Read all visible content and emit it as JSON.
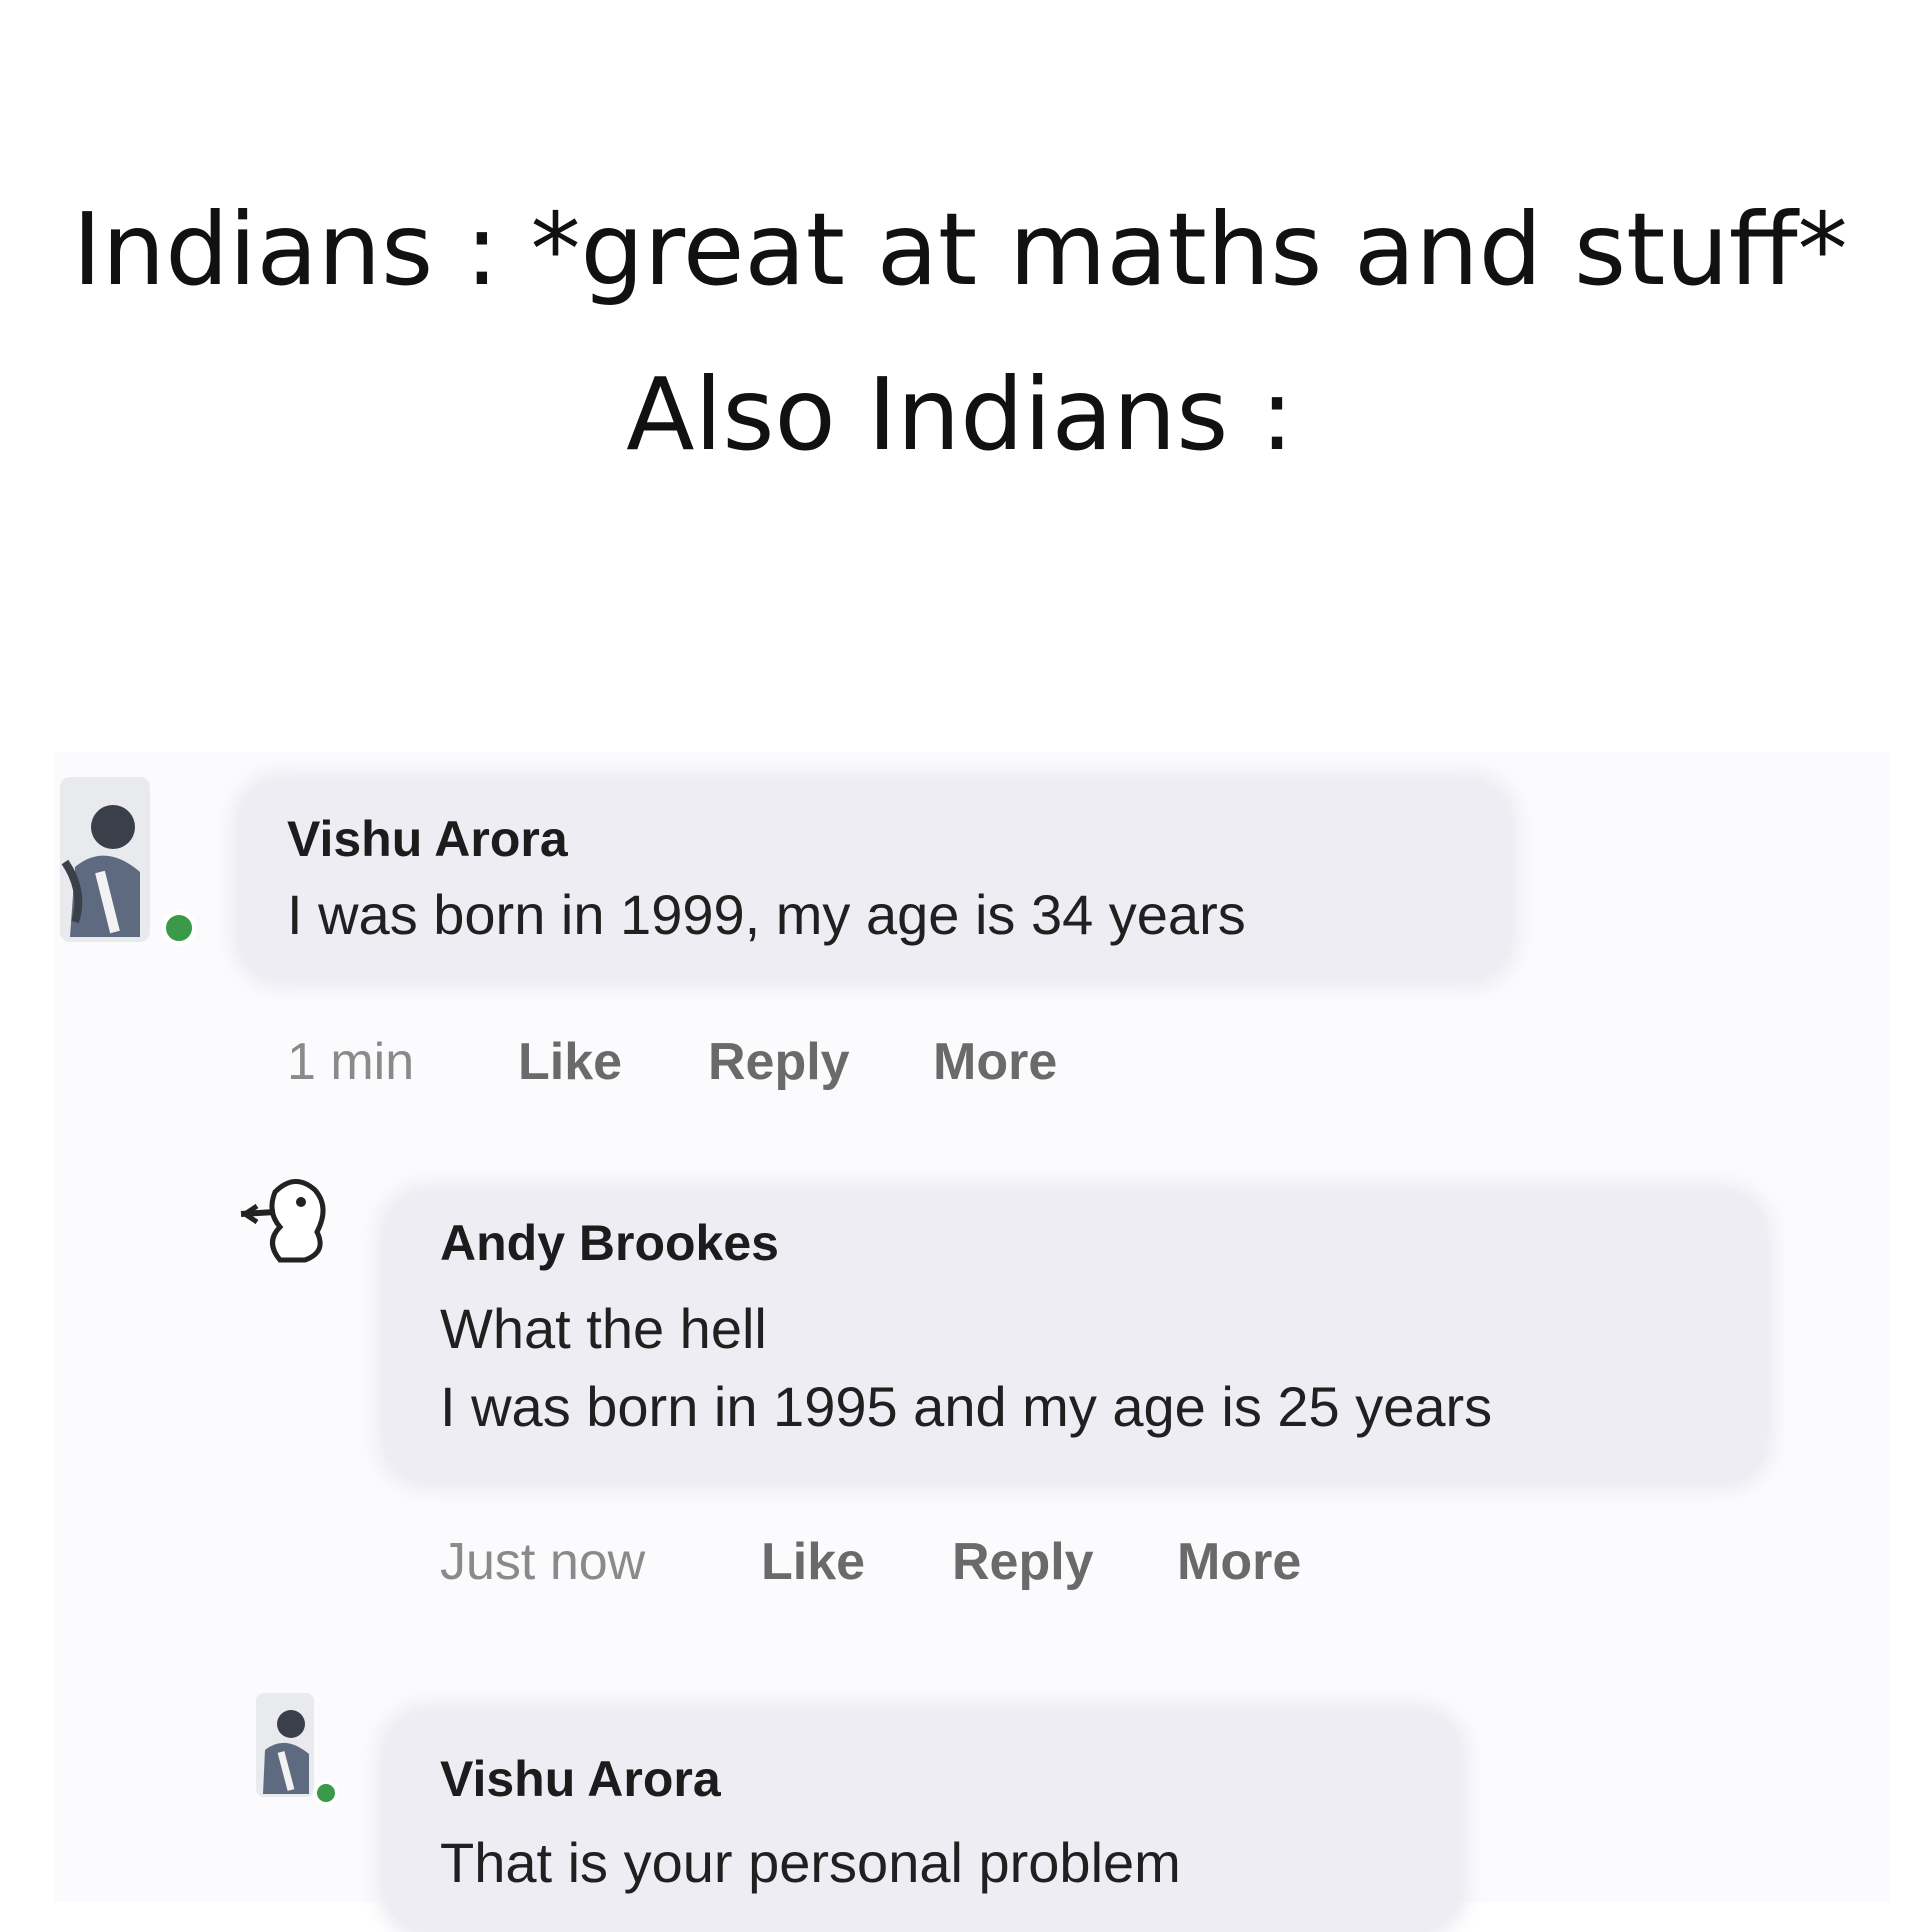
{
  "caption": {
    "line1": "Indians : *great at maths and stuff*",
    "line2": "Also Indians :"
  },
  "comments": [
    {
      "author": "Vishu Arora",
      "lines": [
        "I was born in 1999, my age is 34 years"
      ],
      "time": "1 min",
      "actions": [
        "Like",
        "Reply",
        "More"
      ],
      "online": true
    },
    {
      "author": "Andy Brookes",
      "lines": [
        "What the hell",
        "I was born in 1995 and my age is 25 years"
      ],
      "time": "Just now",
      "actions": [
        "Like",
        "Reply",
        "More"
      ],
      "online": false
    },
    {
      "author": "Vishu Arora",
      "lines": [
        "That is your personal problem"
      ],
      "online": true
    }
  ],
  "colors": {
    "bubble": "#ededf3",
    "online_dot": "#3b9a4a",
    "meta_text": "#8a8a8a"
  }
}
